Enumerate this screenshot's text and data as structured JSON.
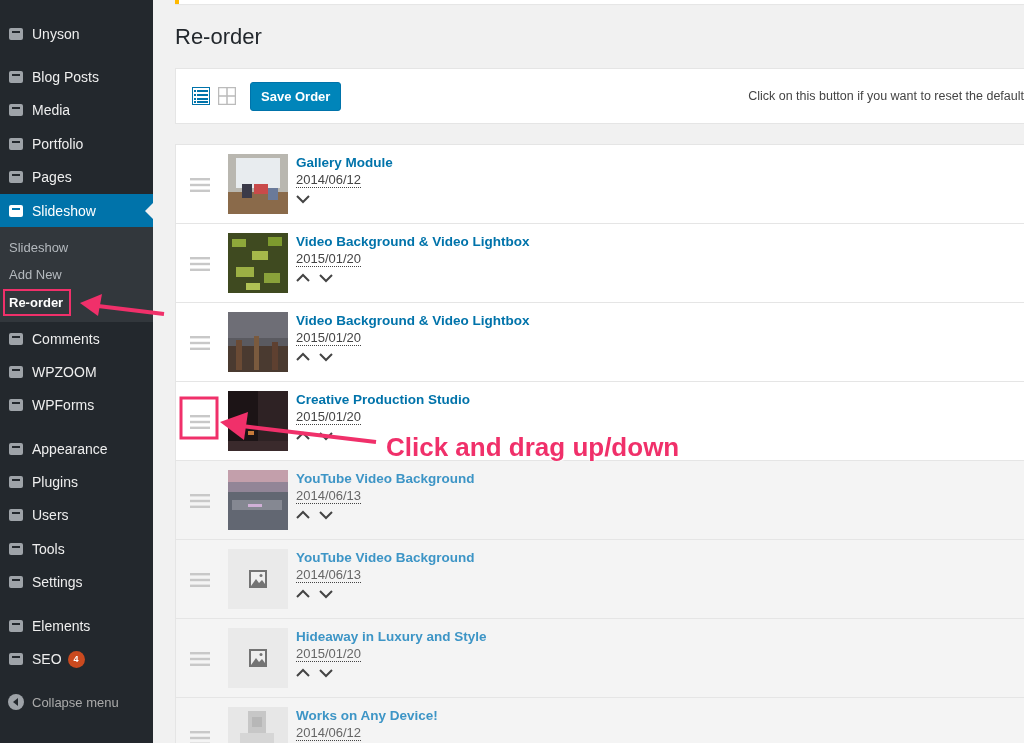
{
  "sidebar": {
    "groups": [
      [
        {
          "label": "Unyson",
          "selected": false
        }
      ],
      [
        {
          "label": "Blog Posts",
          "selected": false
        },
        {
          "label": "Media",
          "selected": false
        },
        {
          "label": "Portfolio",
          "selected": false
        },
        {
          "label": "Pages",
          "selected": false
        },
        {
          "label": "Slideshow",
          "selected": true,
          "submenu": [
            {
              "label": "Slideshow",
              "selected": false,
              "highlighted": false
            },
            {
              "label": "Add New",
              "selected": false,
              "highlighted": false
            },
            {
              "label": "Re-order",
              "selected": true,
              "highlighted": true
            }
          ]
        },
        {
          "label": "Comments",
          "selected": false
        },
        {
          "label": "WPZOOM",
          "selected": false
        },
        {
          "label": "WPForms",
          "selected": false
        }
      ],
      [
        {
          "label": "Appearance",
          "selected": false
        },
        {
          "label": "Plugins",
          "selected": false
        },
        {
          "label": "Users",
          "selected": false
        },
        {
          "label": "Tools",
          "selected": false
        },
        {
          "label": "Settings",
          "selected": false
        }
      ],
      [
        {
          "label": "Elements",
          "selected": false
        },
        {
          "label": "SEO",
          "selected": false,
          "badge": "4"
        }
      ]
    ],
    "collapse": "Collapse menu"
  },
  "page": {
    "title": "Re-order"
  },
  "toolbar": {
    "view_toggles": [
      {
        "selected": true
      },
      {
        "selected": false
      }
    ],
    "save_button": "Save Order",
    "hint": "Click on this button if you want to reset the default"
  },
  "rows": [
    {
      "title": "Gallery Module",
      "date": "2014/06/12",
      "up": false,
      "down": true,
      "dimmed": false
    },
    {
      "title": "Video Background & Video Lightbox",
      "date": "2015/01/20",
      "up": true,
      "down": true,
      "dimmed": false
    },
    {
      "title": "Video Background & Video Lightbox",
      "date": "2015/01/20",
      "up": true,
      "down": true,
      "dimmed": false
    },
    {
      "title": "Creative Production Studio",
      "date": "2015/01/20",
      "up": true,
      "down": true,
      "dimmed": false,
      "annotation": "Click and drag up/down"
    },
    {
      "title": "YouTube Video Background",
      "date": "2014/06/13",
      "up": true,
      "down": true,
      "dimmed": true
    },
    {
      "title": "YouTube Video Background",
      "date": "2014/06/13",
      "thumbnail": {
        "kind": "placeholder"
      },
      "up": true,
      "down": true,
      "dimmed": true
    },
    {
      "title": "Hideaway in Luxury and Style",
      "date": "2015/01/20",
      "thumbnail": {
        "kind": "placeholder"
      },
      "up": true,
      "down": true,
      "dimmed": true
    },
    {
      "title": "Works on Any Device!",
      "date": "2014/06/12",
      "dimmed": true
    }
  ]
}
